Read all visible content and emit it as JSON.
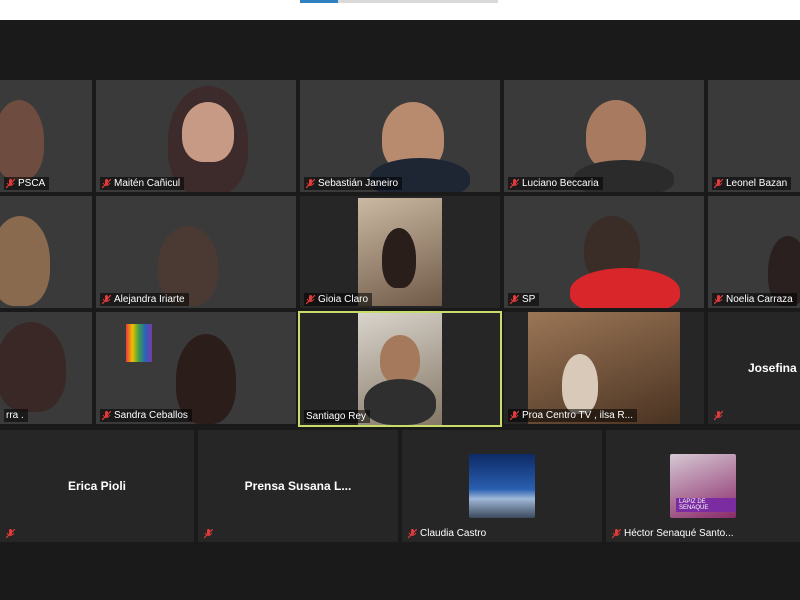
{
  "colors": {
    "background": "#1a1a1a",
    "tile": "#262626",
    "active_speaker_border": "#c8dc6a",
    "muted_mic": "#e23b3b",
    "label_text": "#ffffff"
  },
  "icons": {
    "muted": "microphone-muted-icon"
  },
  "row1": [
    {
      "name": "PSCA"
    },
    {
      "name": "Maitén Cañicul"
    },
    {
      "name": "Sebastián Janeiro"
    },
    {
      "name": "Luciano Beccaria"
    },
    {
      "name": "Leonel Bazan"
    }
  ],
  "row2": [
    {
      "name": ""
    },
    {
      "name": "Alejandra Iriarte"
    },
    {
      "name": "Gioia Claro"
    },
    {
      "name": "SP"
    },
    {
      "name": "Noelia Carraza"
    }
  ],
  "row3": [
    {
      "name": "rra ."
    },
    {
      "name": "Sandra Ceballos"
    },
    {
      "name": "Santiago Rey",
      "active": true
    },
    {
      "name": "Proa Centro TV , ilsa R..."
    },
    {
      "name": "Josefina"
    }
  ],
  "row4": [
    {
      "name": "Erica Pioli"
    },
    {
      "name": "Prensa  Susana  L..."
    },
    {
      "name": "Claudia Castro"
    },
    {
      "name": "Héctor Senaqué Santo..."
    }
  ],
  "promo_thumb_caption": "LAPIZ DE SENAQUE"
}
